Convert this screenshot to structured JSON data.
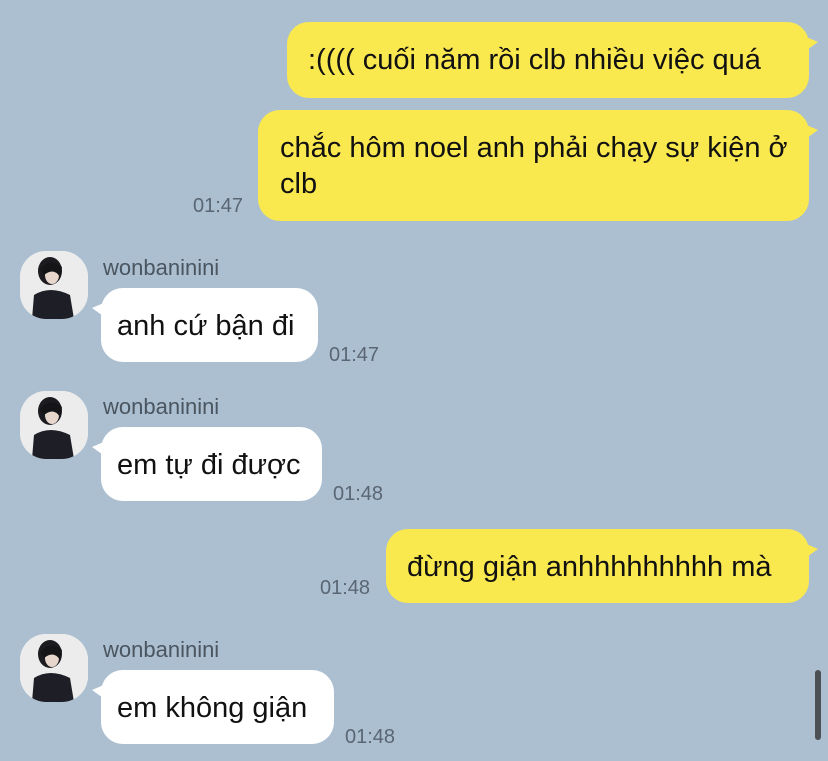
{
  "colors": {
    "background": "#acbfd0",
    "outgoing_bubble": "#fae84f",
    "incoming_bubble": "#ffffff",
    "time_text": "#5a6673"
  },
  "messages": [
    {
      "direction": "out",
      "text": ":(((( cuối năm rồi clb nhiều việc quá",
      "time": ""
    },
    {
      "direction": "out",
      "text": "chắc hôm noel anh phải chạy sự kiện ở clb",
      "time": "01:47"
    },
    {
      "direction": "in",
      "sender": "wonbaninini",
      "avatar_icon": "user-avatar-icon",
      "text": "anh cứ bận đi",
      "time": "01:47"
    },
    {
      "direction": "in",
      "sender": "wonbaninini",
      "avatar_icon": "user-avatar-icon",
      "text": "em tự đi được",
      "time": "01:48"
    },
    {
      "direction": "out",
      "text": "đừng giận anhhhhhhhhh mà",
      "time": "01:48"
    },
    {
      "direction": "in",
      "sender": "wonbaninini",
      "avatar_icon": "user-avatar-icon",
      "text": "em không giận",
      "time": "01:48"
    }
  ]
}
